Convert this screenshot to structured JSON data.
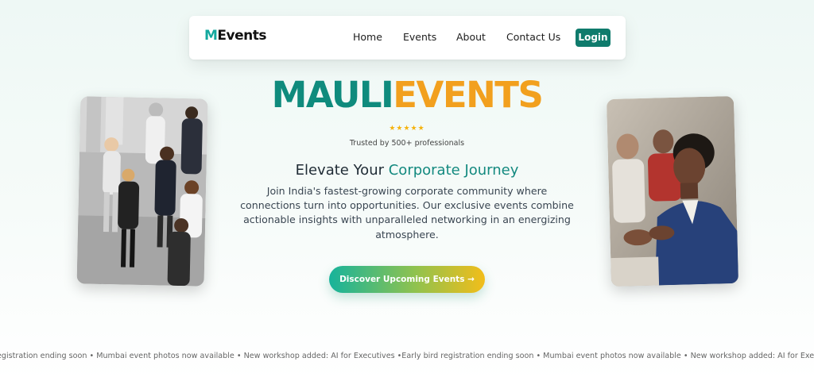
{
  "navbar": {
    "brand_prefix": "M",
    "brand_rest": "Events",
    "links": [
      "Home",
      "Events",
      "About",
      "Contact Us"
    ],
    "login_label": "Login"
  },
  "hero": {
    "title_part1": "MAULI",
    "title_part2": "EVENTS",
    "stars": "★★★★★",
    "trusted_text": "Trusted by 500+ professionals",
    "subtitle_plain": "Elevate Your ",
    "subtitle_accent": "Corporate Journey",
    "description": "Join India's fastest-growing corporate community where connections turn into opportunities. Our exclusive events combine actionable insights with unparalleled networking in an energizing atmosphere.",
    "cta_label": "Discover Upcoming Events →"
  },
  "ticker": {
    "text": "egistration ending soon • Mumbai event photos now available • New workshop added: AI for Executives •Early bird registration ending soon • Mumbai event photos now available • New workshop added: AI for Executives •"
  },
  "colors": {
    "brand_teal": "#0f8b7d",
    "brand_orange": "#f2a01e",
    "login_bg": "#0f7b6c",
    "star": "#f5b30f"
  }
}
